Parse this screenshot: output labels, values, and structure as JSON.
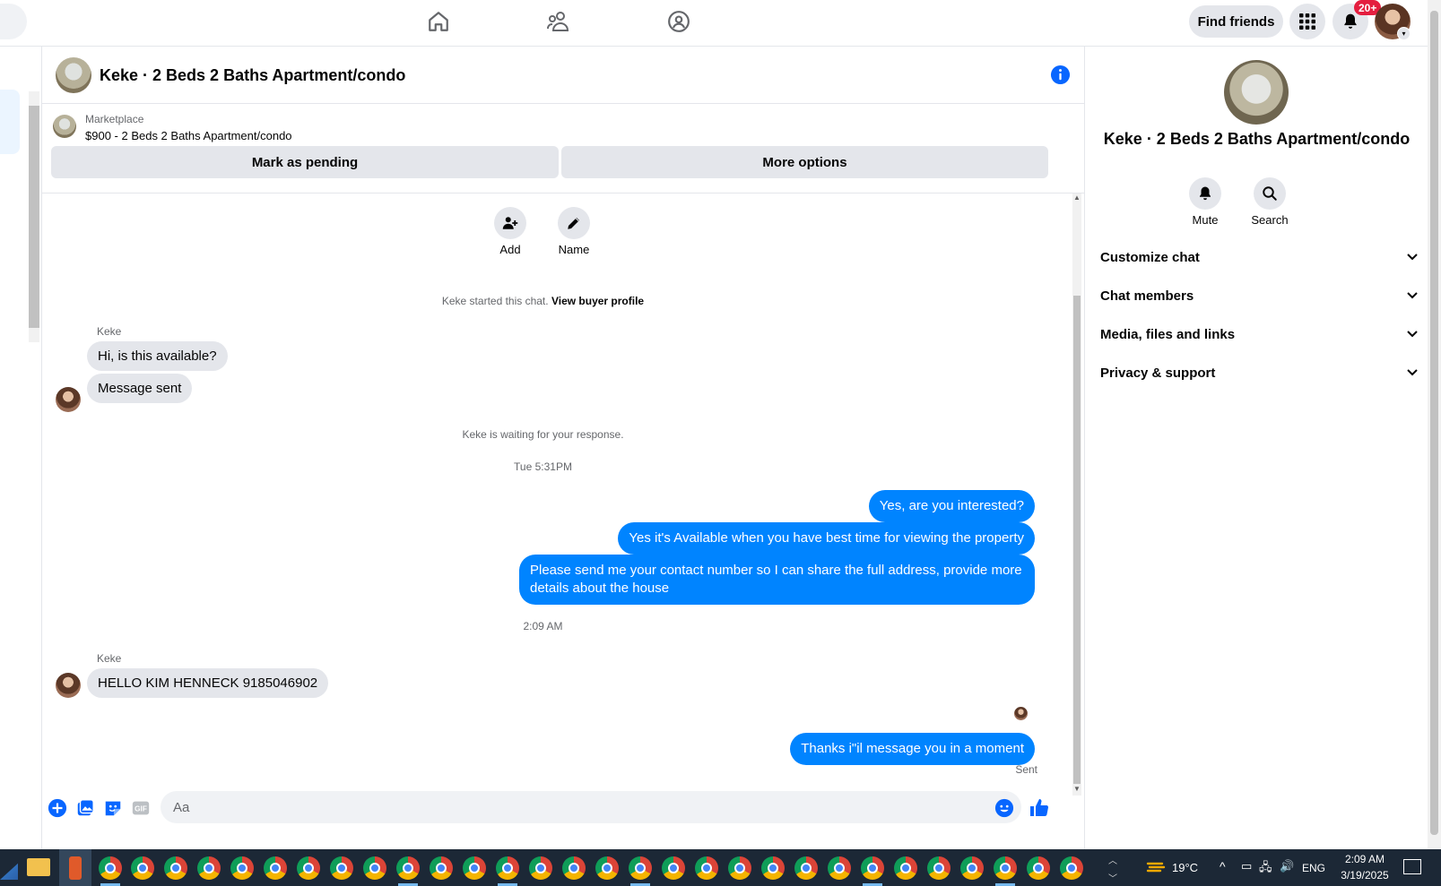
{
  "topbar": {
    "find_friends": "Find friends",
    "notification_count": "20+"
  },
  "chat": {
    "title": "Keke · 2 Beds 2 Baths Apartment/condo",
    "marketplace_label": "Marketplace",
    "listing": "$900 - 2 Beds 2 Baths Apartment/condo",
    "mark_pending": "Mark as pending",
    "more_options": "More options",
    "add_label": "Add",
    "name_label": "Name",
    "started_prefix": "Keke started this chat.",
    "view_buyer": "View buyer profile",
    "waiting": "Keke is waiting for your response.",
    "timestamp1": "Tue 5:31PM",
    "timestamp2": "2:09 AM",
    "sent_status": "Sent",
    "messages": {
      "m1_sender": "Keke",
      "m1": "Hi, is this available?",
      "m2": "Message sent",
      "o1": "Yes, are you interested?",
      "o2": "Yes it's Available when you have best time for viewing the property",
      "o3": "Please send me your contact number so I can share the full address, provide more details about the house",
      "m3_sender": "Keke",
      "m3": "HELLO KIM HENNECK 9185046902",
      "o4": "Thanks i\"il message you in a moment"
    },
    "composer_placeholder": "Aa"
  },
  "right_panel": {
    "title": "Keke · 2 Beds 2 Baths Apartment/condo",
    "mute": "Mute",
    "search": "Search",
    "sections": [
      "Customize chat",
      "Chat members",
      "Media, files and links",
      "Privacy & support"
    ]
  },
  "taskbar": {
    "temperature": "19°C",
    "language": "ENG",
    "time": "2:09 AM",
    "date": "3/19/2025"
  },
  "colors": {
    "messenger_blue": "#0084ff",
    "facebook_blue": "#0866ff",
    "bubble_gray": "#e4e6eb"
  },
  "icons": [
    "home-icon",
    "friends-icon",
    "groups-icon",
    "grid-menu-icon",
    "bell-icon",
    "info-icon",
    "add-person-icon",
    "pencil-icon",
    "plus-icon",
    "photo-icon",
    "sticker-icon",
    "gif-icon",
    "emoji-icon",
    "like-icon",
    "chevron-down-icon",
    "search-icon"
  ]
}
